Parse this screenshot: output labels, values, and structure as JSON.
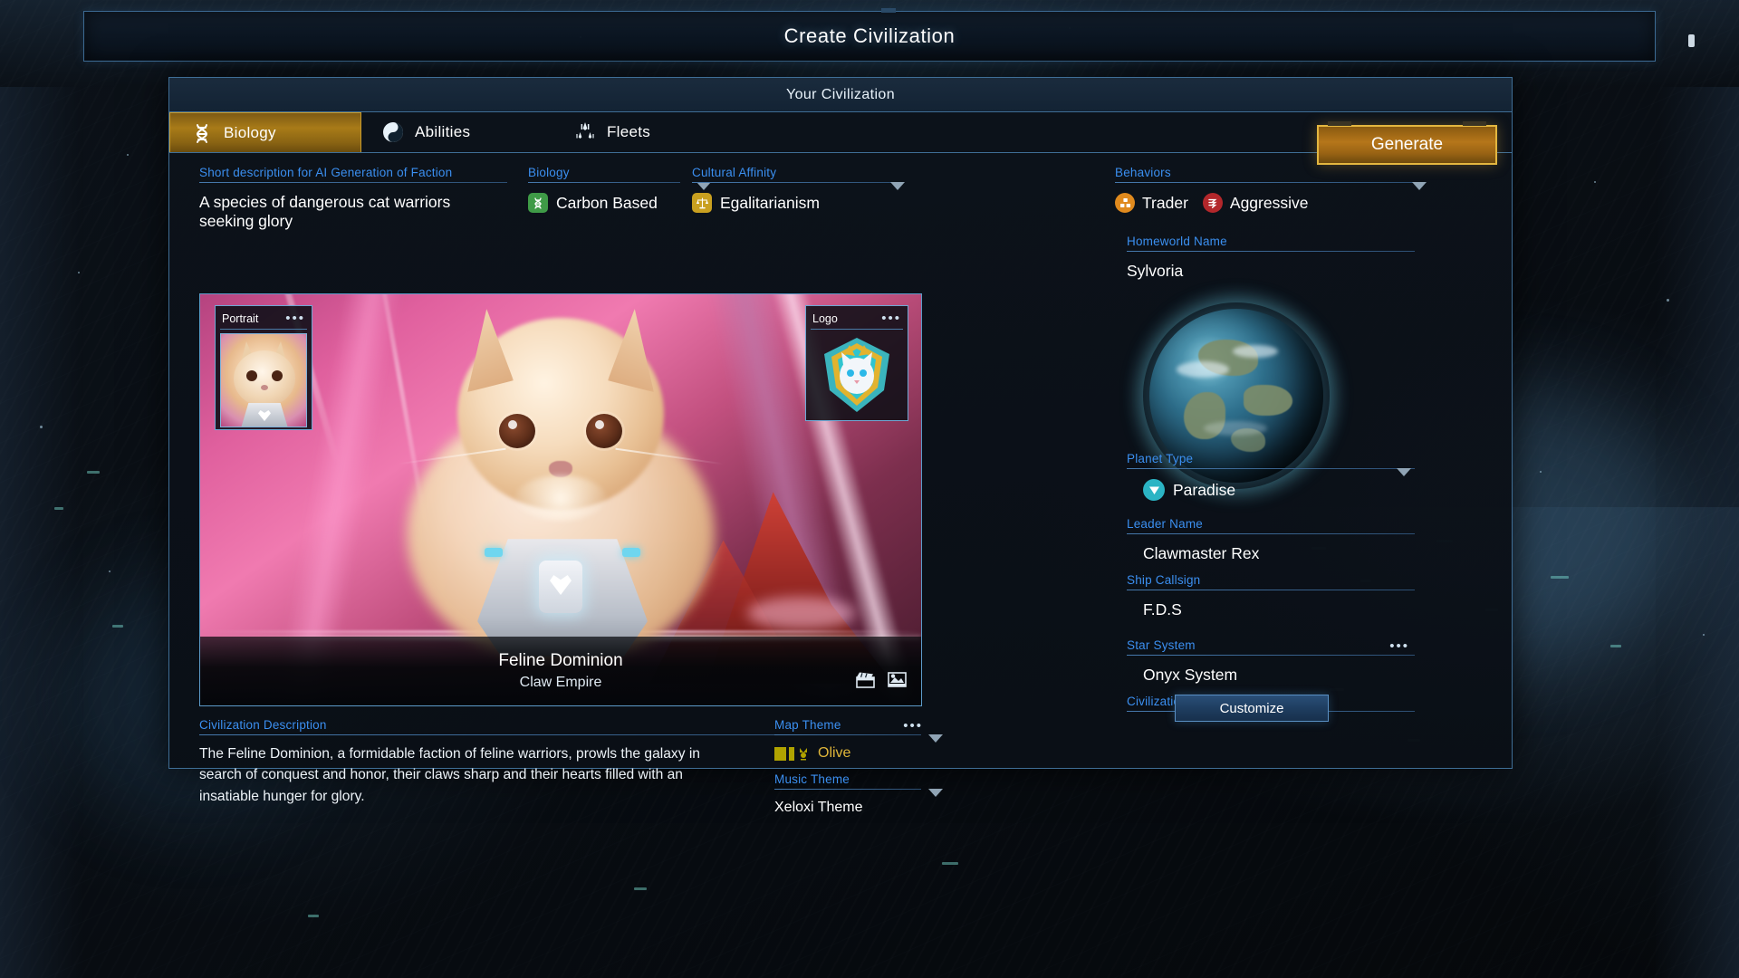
{
  "topbar": {
    "title": "Create Civilization"
  },
  "window": {
    "title": "Your Civilization"
  },
  "tabs": [
    {
      "label": "Biology",
      "icon": "dna-icon",
      "active": true
    },
    {
      "label": "Abilities",
      "icon": "yin-yang-icon",
      "active": false
    },
    {
      "label": "Fleets",
      "icon": "fleet-icon",
      "active": false
    }
  ],
  "generate": {
    "label": "Generate"
  },
  "fields": {
    "short_description": {
      "label": "Short description for AI Generation of Faction",
      "value": "A species of dangerous cat warriors seeking glory"
    },
    "biology": {
      "label": "Biology",
      "value": "Carbon Based",
      "icon": "dna-badge-icon",
      "icon_color": "#3f9b47"
    },
    "cultural_affinity": {
      "label": "Cultural Affinity",
      "value": "Egalitarianism",
      "icon": "scales-badge-icon",
      "icon_color": "#c9a020"
    },
    "behaviors": {
      "label": "Behaviors",
      "items": [
        {
          "label": "Trader",
          "icon": "trader-badge-icon",
          "icon_color": "#e08a1e"
        },
        {
          "label": "Aggressive",
          "icon": "aggressive-badge-icon",
          "icon_color": "#b3272b"
        }
      ]
    },
    "homeworld_name": {
      "label": "Homeworld Name",
      "value": "Sylvoria"
    },
    "planet_type": {
      "label": "Planet Type",
      "value": "Paradise",
      "icon": "paradise-badge-icon",
      "icon_color": "#2bb4c4"
    },
    "leader_name": {
      "label": "Leader Name",
      "value": "Clawmaster Rex"
    },
    "ship_callsign": {
      "label": "Ship Callsign",
      "value": "F.D.S"
    },
    "star_system": {
      "label": "Star System",
      "value": "Onyx System"
    },
    "civilization_lore": {
      "label": "Civilization lore",
      "button": "Customize"
    },
    "civilization_description": {
      "label": "Civilization Description",
      "value": "The Feline Dominion, a formidable faction of feline warriors, prowls the galaxy in search of conquest and honor, their claws sharp and their hearts filled with an insatiable hunger for glory."
    },
    "map_theme": {
      "label": "Map Theme",
      "value": "Olive",
      "swatch_color": "#b0a300"
    },
    "music_theme": {
      "label": "Music Theme",
      "value": "Xeloxi Theme"
    }
  },
  "art_panel": {
    "portrait_card": {
      "title": "Portrait"
    },
    "logo_card": {
      "title": "Logo"
    },
    "faction_name": "Feline Dominion",
    "faction_subtitle": "Claw Empire",
    "icons": [
      "video-clapper-icon",
      "image-picture-icon"
    ]
  },
  "colors": {
    "accent_blue": "#3b8ff0",
    "panel_border": "#3f6e96",
    "tab_active_gold": "#c79a2c",
    "generate_gold": "#e3b640",
    "customize_blue": "#5a90c4"
  }
}
